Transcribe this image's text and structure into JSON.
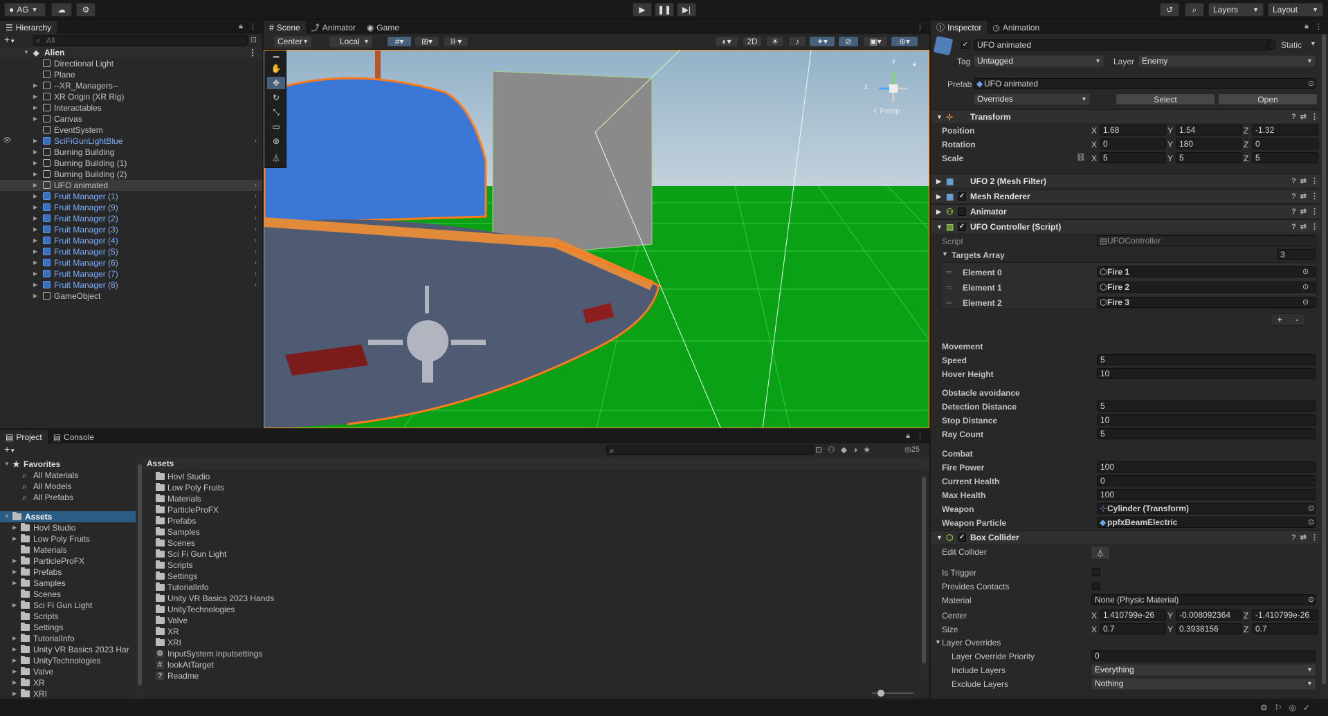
{
  "toolbar": {
    "account": "AG",
    "layers": "Layers",
    "layout": "Layout"
  },
  "hierarchy": {
    "tab": "Hierarchy",
    "search_placeholder": "All",
    "root": "Alien",
    "items": [
      {
        "label": "Directional Light",
        "blue": false,
        "expand": false
      },
      {
        "label": "Plane",
        "blue": false,
        "expand": false
      },
      {
        "label": "--XR_Managers--",
        "blue": false,
        "expand": true
      },
      {
        "label": "XR Origin (XR Rig)",
        "blue": false,
        "expand": true
      },
      {
        "label": "Interactables",
        "blue": false,
        "expand": true
      },
      {
        "label": "Canvas",
        "blue": false,
        "expand": true
      },
      {
        "label": "EventSystem",
        "blue": false,
        "expand": false
      },
      {
        "label": "SciFiGunLightBlue",
        "blue": true,
        "expand": true
      },
      {
        "label": "Burning Building",
        "blue": false,
        "expand": true
      },
      {
        "label": "Burning Building (1)",
        "blue": false,
        "expand": true
      },
      {
        "label": "Burning Building (2)",
        "blue": false,
        "expand": true
      },
      {
        "label": "UFO animated",
        "blue": false,
        "expand": true
      },
      {
        "label": "Fruit Manager (1)",
        "blue": true,
        "expand": true
      },
      {
        "label": "Fruit Manager (9)",
        "blue": true,
        "expand": true
      },
      {
        "label": "Fruit Manager (2)",
        "blue": true,
        "expand": true
      },
      {
        "label": "Fruit Manager (3)",
        "blue": true,
        "expand": true
      },
      {
        "label": "Fruit Manager (4)",
        "blue": true,
        "expand": true
      },
      {
        "label": "Fruit Manager (5)",
        "blue": true,
        "expand": true
      },
      {
        "label": "Fruit Manager (6)",
        "blue": true,
        "expand": true
      },
      {
        "label": "Fruit Manager (7)",
        "blue": true,
        "expand": true
      },
      {
        "label": "Fruit Manager (8)",
        "blue": true,
        "expand": true
      },
      {
        "label": "GameObject",
        "blue": false,
        "expand": true
      }
    ]
  },
  "scene": {
    "tabs": [
      "Scene",
      "Animator",
      "Game"
    ],
    "pivot": "Center",
    "space": "Local",
    "mode_2d": "2D",
    "persp": "< Persp",
    "gizmo_y": "y",
    "gizmo_z": "z"
  },
  "inspector": {
    "tabs": [
      "Inspector",
      "Animation"
    ],
    "object_name": "UFO animated",
    "static_label": "Static",
    "tag_label": "Tag",
    "tag_value": "Untagged",
    "layer_label": "Layer",
    "layer_value": "Enemy",
    "prefab_label": "Prefab",
    "prefab_value": "UFO animated",
    "overrides": "Overrides",
    "select": "Select",
    "open": "Open",
    "transform": {
      "title": "Transform",
      "position": {
        "label": "Position",
        "x": "1.68",
        "y": "1.54",
        "z": "-1.32"
      },
      "rotation": {
        "label": "Rotation",
        "x": "0",
        "y": "180",
        "z": "0"
      },
      "scale": {
        "label": "Scale",
        "x": "5",
        "y": "5",
        "z": "5"
      }
    },
    "mesh_filter": "UFO 2 (Mesh Filter)",
    "mesh_renderer": "Mesh Renderer",
    "animator": "Animator",
    "ufo_controller": {
      "title": "UFO Controller (Script)",
      "script_label": "Script",
      "script_value": "UFOController",
      "targets_label": "Targets Array",
      "targets_count": "3",
      "elements": [
        {
          "label": "Element 0",
          "value": "Fire 1"
        },
        {
          "label": "Element 1",
          "value": "Fire 2"
        },
        {
          "label": "Element 2",
          "value": "Fire 3"
        }
      ],
      "add": "+",
      "remove": "-",
      "movement": "Movement",
      "speed_label": "Speed",
      "speed": "5",
      "hover_label": "Hover Height",
      "hover": "10",
      "obstacle": "Obstacle avoidance",
      "detect_label": "Detection Distance",
      "detect": "5",
      "stop_label": "Stop Distance",
      "stop": "10",
      "ray_label": "Ray Count",
      "ray": "5",
      "combat": "Combat",
      "fire_label": "Fire Power",
      "fire": "100",
      "cur_label": "Current Health",
      "cur": "0",
      "max_label": "Max Health",
      "max": "100",
      "weapon_label": "Weapon",
      "weapon": "Cylinder (Transform)",
      "particle_label": "Weapon Particle",
      "particle": "ppfxBeamElectric"
    },
    "box_collider": {
      "title": "Box Collider",
      "edit_label": "Edit Collider",
      "trigger_label": "Is Trigger",
      "contacts_label": "Provides Contacts",
      "material_label": "Material",
      "material": "None (Physic Material)",
      "center_label": "Center",
      "cx": "1.410799e-26",
      "cy": "-0.008092364",
      "cz": "-1.410799e-26",
      "size_label": "Size",
      "sx": "0.7",
      "sy": "0.3938156",
      "sz": "0.7",
      "layer_overrides": "Layer Overrides",
      "priority_label": "Layer Override Priority",
      "priority": "0",
      "include_label": "Include Layers",
      "include": "Everything",
      "exclude_label": "Exclude Layers",
      "exclude": "Nothing"
    }
  },
  "project": {
    "tabs": [
      "Project",
      "Console"
    ],
    "count": "25",
    "favorites": "Favorites",
    "fav_items": [
      "All Materials",
      "All Models",
      "All Prefabs"
    ],
    "assets": "Assets",
    "tree": [
      "Hovl Studio",
      "Low Poly Fruits",
      "Materials",
      "ParticleProFX",
      "Prefabs",
      "Samples",
      "Scenes",
      "Sci Fi Gun Light",
      "Scripts",
      "Settings",
      "TutorialInfo",
      "Unity VR Basics 2023 Har",
      "UnityTechnologies",
      "Valve",
      "XR",
      "XRI"
    ],
    "list_header": "Assets",
    "list": [
      "Hovl Studio",
      "Low Poly Fruits",
      "Materials",
      "ParticleProFX",
      "Prefabs",
      "Samples",
      "Scenes",
      "Sci Fi Gun Light",
      "Scripts",
      "Settings",
      "TutorialInfo",
      "Unity VR Basics 2023 Hands",
      "UnityTechnologies",
      "Valve",
      "XR",
      "XRI"
    ],
    "files": [
      "InputSystem.inputsettings",
      "lookAtTarget",
      "Readme"
    ]
  }
}
